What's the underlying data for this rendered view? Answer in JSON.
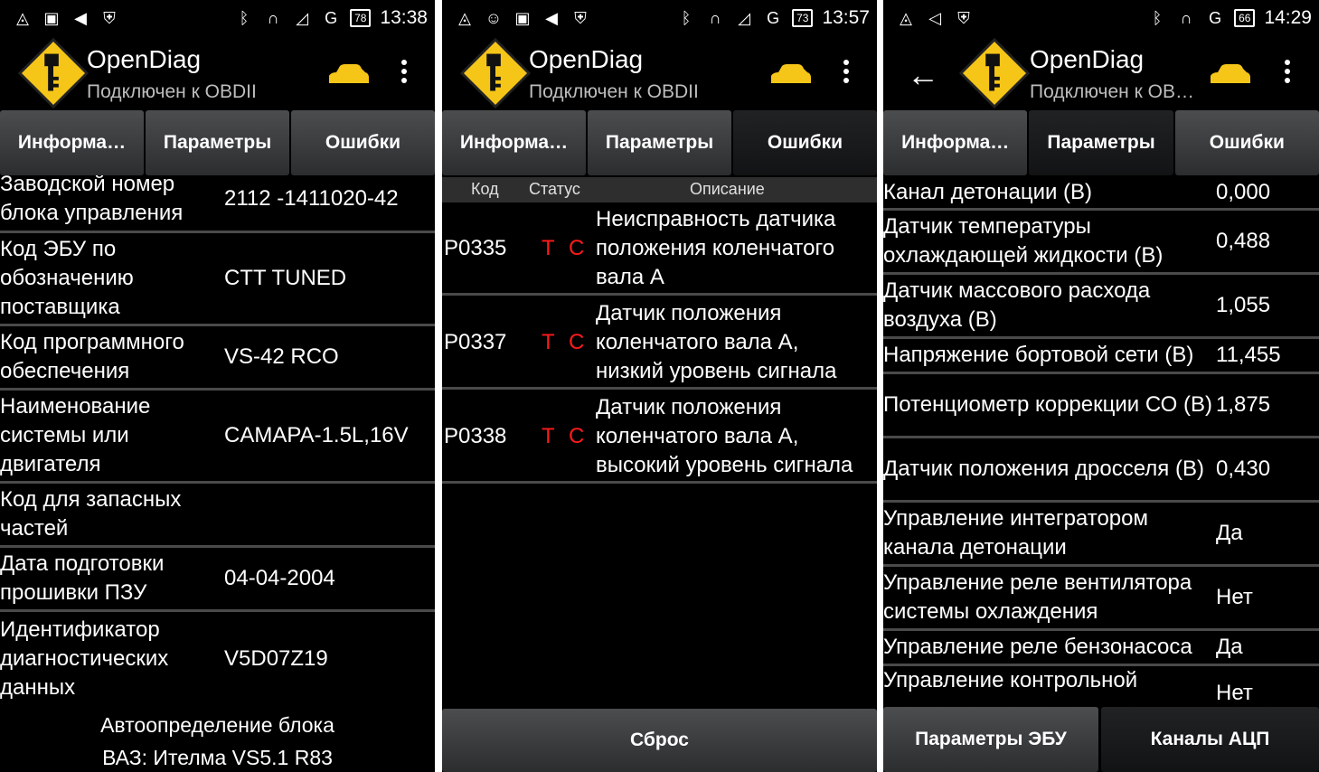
{
  "status_bars": [
    {
      "time": "13:38",
      "battery": "78"
    },
    {
      "time": "13:57",
      "battery": "73"
    },
    {
      "time": "14:29",
      "battery": "66"
    }
  ],
  "app": {
    "title": "OpenDiag",
    "subtitle": "Подключен к OBDII",
    "subtitle_short": "Подключен к OB…",
    "logo_icon": "key-warning-sign-icon",
    "car_icon": "car-icon",
    "menu_icon": "overflow-menu-icon",
    "accent": "#f5c518"
  },
  "tabs": [
    "Информа…",
    "Параметры",
    "Ошибки"
  ],
  "info_screen": {
    "rows": [
      {
        "label": "Заводской номер блока управления",
        "value": "2112 -1411020-42"
      },
      {
        "label": "Код ЭБУ по обозначению поставщика",
        "value": "CTT TUNED"
      },
      {
        "label": "Код программного обеспечения",
        "value": "VS-42 RCO"
      },
      {
        "label": "Наименование системы или двигателя",
        "value": "CAMAPA-1.5L,16V"
      },
      {
        "label": "Код для запасных частей",
        "value": ""
      },
      {
        "label": "Дата подготовки прошивки ПЗУ",
        "value": "04-04-2004"
      },
      {
        "label": "Идентификатор диагностических данных",
        "value": "V5D07Z19"
      }
    ],
    "footer_line1": "Автоопределение блока",
    "footer_line2": "ВАЗ: Ителма VS5.1 R83"
  },
  "errors_screen": {
    "headers": {
      "code": "Код",
      "status": "Статус",
      "description": "Описание"
    },
    "rows": [
      {
        "code": "P0335",
        "status_t": "T",
        "status_c": "C",
        "description": "Неисправность датчика положения коленчатого вала А"
      },
      {
        "code": "P0337",
        "status_t": "T",
        "status_c": "C",
        "description": "Датчик положения коленчатого вала А, низкий уровень сигнала"
      },
      {
        "code": "P0338",
        "status_t": "T",
        "status_c": "C",
        "description": "Датчик положения коленчатого вала А, высокий уровень сигнала"
      }
    ],
    "reset_label": "Сброс",
    "status_color": "#ff1a1a"
  },
  "params_screen": {
    "rows": [
      {
        "label": "Канал детонации (В)",
        "value": "0,000"
      },
      {
        "label": "Датчик температуры охлаждающей жидкости (В)",
        "value": "0,488"
      },
      {
        "label": "Датчик массового расхода воздуха (В)",
        "value": "1,055"
      },
      {
        "label": "Напряжение бортовой сети (В)",
        "value": "11,455"
      },
      {
        "label": "Потенциометр коррекции СО (В)",
        "value": "1,875"
      },
      {
        "label": "Датчик положения дросселя (В)",
        "value": "0,430"
      },
      {
        "label": "Управление интегратором канала детонации",
        "value": "Да"
      },
      {
        "label": "Управление реле вентилятора системы охлаждения",
        "value": "Нет"
      },
      {
        "label": "Управление реле бензонасоса",
        "value": "Да"
      },
      {
        "label": "Управление контрольной",
        "value": "Нет"
      }
    ],
    "bottom_tabs": [
      "Параметры ЭБУ",
      "Каналы АЦП"
    ]
  }
}
